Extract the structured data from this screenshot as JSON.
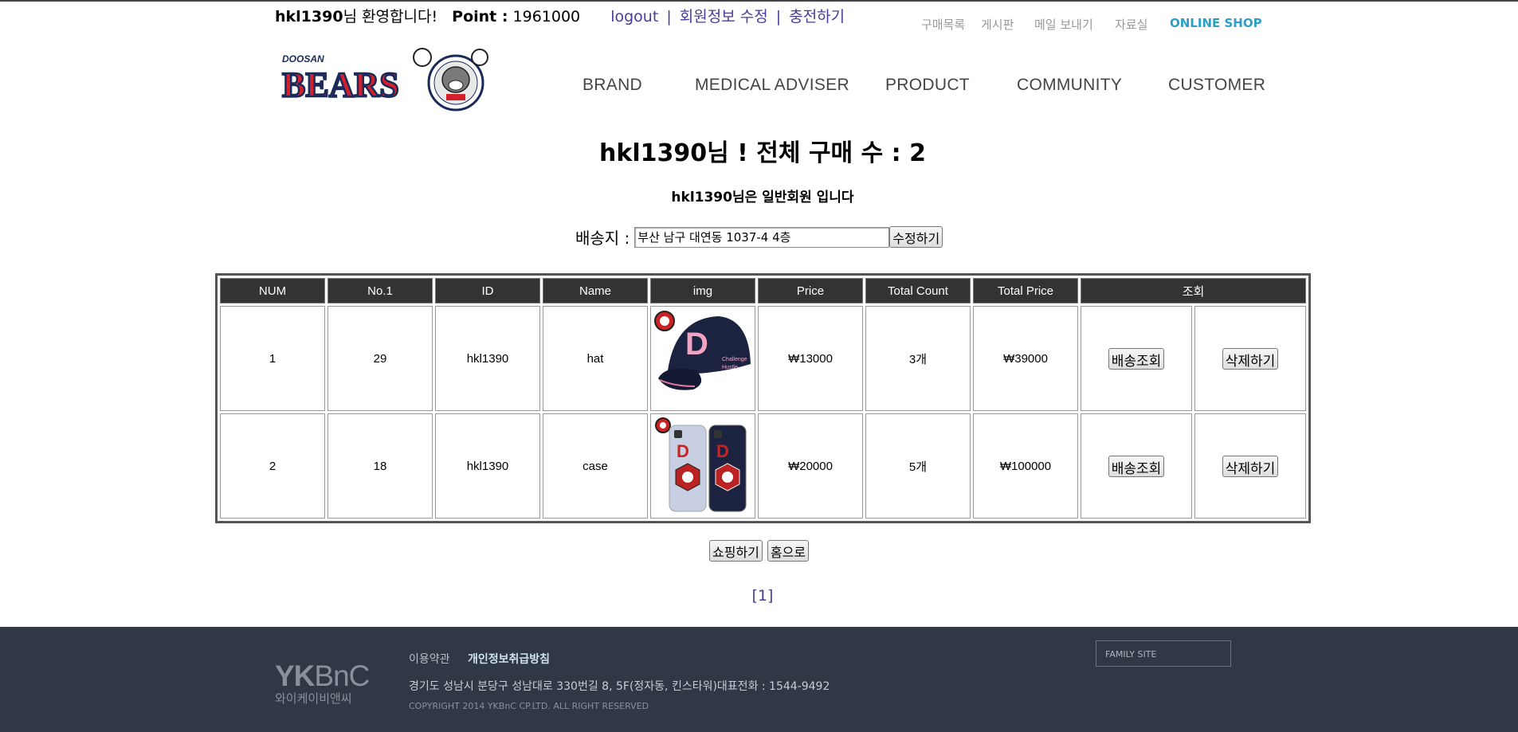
{
  "userbar": {
    "user_id": "hkl1390",
    "welcome": "님 환영합니다!",
    "point_label": "Point :",
    "point_value": "1961000",
    "logout": "logout",
    "edit_member": "회원정보 수정",
    "charge": "충전하기",
    "sep": "|"
  },
  "util_links": [
    "구매목록",
    "게시판",
    "메일 보내기",
    "자료실",
    "ONLINE SHOP"
  ],
  "logo": {
    "brand_small": "DOOSAN",
    "brand_big": "BEARS"
  },
  "nav": [
    "BRAND",
    "MEDICAL ADVISER",
    "PRODUCT",
    "COMMUNITY",
    "CUSTOMER"
  ],
  "heading": "hkl1390님 ! 전체 구매 수 : 2",
  "subheading_id": "hkl1390",
  "subheading_text": "님은 일반회원 입니다",
  "address": {
    "label": "배송지 :",
    "value": "부산 남구 대연동 1037-4 4층",
    "button": "수정하기"
  },
  "table": {
    "headers": [
      "NUM",
      "No.1",
      "ID",
      "Name",
      "img",
      "Price",
      "Total Count",
      "Total Price",
      "조회"
    ],
    "rows": [
      {
        "num": "1",
        "no": "29",
        "id": "hkl1390",
        "name": "hat",
        "img": "cap-image",
        "price": "₩13000",
        "count": "3개",
        "total": "₩39000",
        "track": "배송조회",
        "delete": "삭제하기"
      },
      {
        "num": "2",
        "no": "18",
        "id": "hkl1390",
        "name": "case",
        "img": "phone-case-image",
        "price": "₩20000",
        "count": "5개",
        "total": "₩100000",
        "track": "배송조회",
        "delete": "삭제하기"
      }
    ]
  },
  "buttons": {
    "shopping": "쇼핑하기",
    "home": "홈으로"
  },
  "pager": "[1]",
  "footer": {
    "logo_big_a": "YK",
    "logo_big_b": "BnC",
    "logo_small": "와이케이비앤씨",
    "terms": "이용약관",
    "privacy": "개인정보취급방침",
    "address": "경기도 성남시 분당구 성남대로 330번길 8, 5F(정자동, 킨스타워)대표전화 : 1544-9492",
    "copyright": "COPYRIGHT 2014 YKBnC CP.LTD. ALL RIGHT RESERVED",
    "family_site": "FAMILY SITE"
  }
}
